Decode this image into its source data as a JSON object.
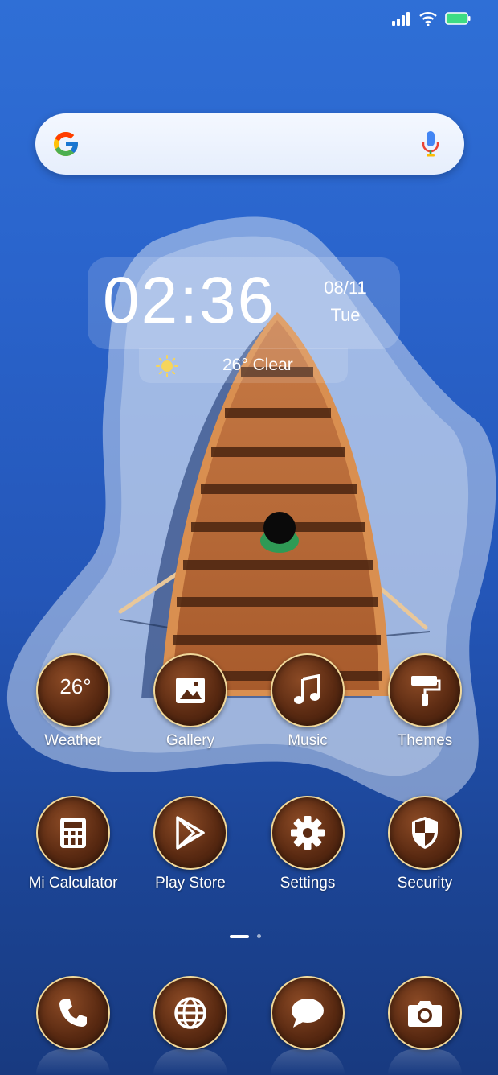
{
  "status_bar": {
    "signal_icon": "signal-icon",
    "wifi_icon": "wifi-icon",
    "battery_icon": "battery-icon",
    "battery_color": "#3ddc84"
  },
  "search": {
    "logo_icon": "google-logo-icon",
    "mic_icon": "mic-icon"
  },
  "clock": {
    "time": "02:36",
    "date": "08/11",
    "day": "Tue"
  },
  "weather_widget": {
    "icon": "sun-icon",
    "text": "26° Clear"
  },
  "apps": [
    {
      "label": "Weather",
      "icon": "weather-icon",
      "temp": "26°"
    },
    {
      "label": "Gallery",
      "icon": "image-icon"
    },
    {
      "label": "Music",
      "icon": "music-note-icon"
    },
    {
      "label": "Themes",
      "icon": "paint-roller-icon"
    },
    {
      "label": "Mi Calculator",
      "icon": "calculator-icon"
    },
    {
      "label": "Play Store",
      "icon": "play-store-icon"
    },
    {
      "label": "Settings",
      "icon": "gear-icon"
    },
    {
      "label": "Security",
      "icon": "shield-icon"
    }
  ],
  "page_indicator": {
    "pages": 2,
    "current": 1
  },
  "dock": [
    {
      "icon": "phone-icon"
    },
    {
      "icon": "globe-icon"
    },
    {
      "icon": "message-icon"
    },
    {
      "icon": "camera-icon"
    }
  ],
  "colors": {
    "icon_bg": "#5a2a12",
    "icon_ring": "#f0d89a",
    "wallpaper_blue": "#2a64cc"
  }
}
